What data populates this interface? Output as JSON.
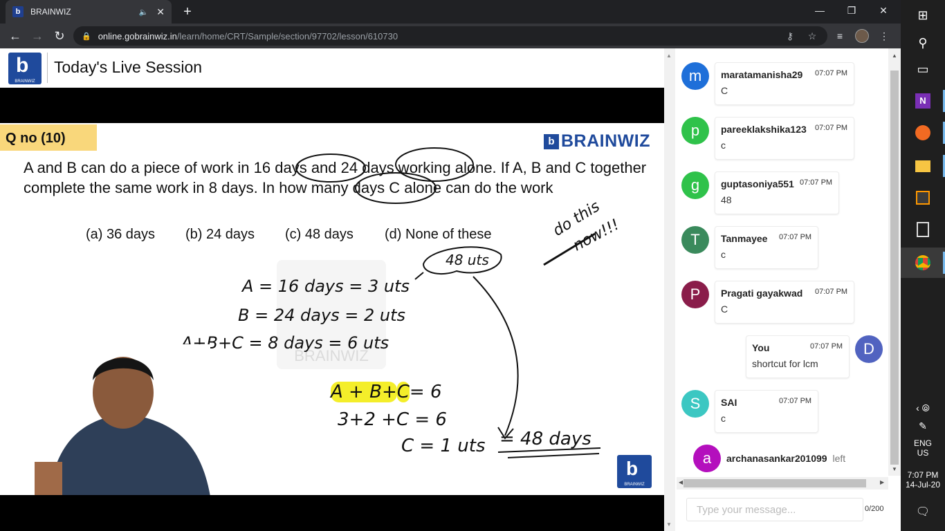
{
  "browser": {
    "tab_title": "BRAINWIZ",
    "favicon_letter": "b",
    "url_host": "online.gobrainwiz.in",
    "url_path": "/learn/home/CRT/Sample/section/97702/lesson/610730"
  },
  "header": {
    "logo_letter": "b",
    "logo_caption": "BRAINWIZ",
    "title": "Today's Live Session"
  },
  "slide": {
    "qno": "Q no (10)",
    "brand": "BRAINWIZ",
    "question": "A and B can do a piece of work in 16 days and 24 days working alone. If A, B and C together complete the same work in 8 days. In how many days C alone can do the work",
    "options": [
      "(a) 36 days",
      "(b) 24 days",
      "(c) 48 days",
      "(d) None of these"
    ],
    "handwriting": {
      "line1": "A = 16 days = 3 uts",
      "line2": "B = 24 days = 2 uts",
      "line3": "A+B+C = 8 days = 6 uts",
      "cloud": "48 uts",
      "eq1a": "A + B+",
      "eq1b": "C",
      "eq1c": "= 6",
      "eq2": "3+2 +C = 6",
      "eq3": "C = 1 uts",
      "answer": "= 48 days",
      "note1": "do this",
      "note2": "now!!!"
    },
    "watermark": "BRAINWIZ",
    "corner_logo_letter": "b",
    "corner_logo_caption": "BRAINWIZ"
  },
  "chat": {
    "messages": [
      {
        "initial": "m",
        "color": "#1e6fd9",
        "user": "maratamanisha29",
        "time": "07:07 PM",
        "text": "C"
      },
      {
        "initial": "p",
        "color": "#2fc24a",
        "user": "pareeklakshika123",
        "time": "07:07 PM",
        "text": "c"
      },
      {
        "initial": "g",
        "color": "#2fc24a",
        "user": "guptasoniya551",
        "time": "07:07 PM",
        "text": "48"
      },
      {
        "initial": "T",
        "color": "#3a8a5c",
        "user": "Tanmayee",
        "time": "07:07 PM",
        "text": "c"
      },
      {
        "initial": "P",
        "color": "#8a1d4a",
        "user": "Pragati gayakwad",
        "time": "07:07 PM",
        "text": "C"
      },
      {
        "initial": "D",
        "color": "#5163c0",
        "user": "You",
        "time": "07:07 PM",
        "text": "shortcut for lcm"
      },
      {
        "initial": "S",
        "color": "#3cc7c2",
        "user": "SAI",
        "time": "07:07 PM",
        "text": "c"
      }
    ],
    "system": {
      "initial": "a",
      "color": "#b40fbd",
      "user": "archanasankar201099",
      "action": "left"
    },
    "input_placeholder": "Type your message...",
    "char_count": "0/200"
  },
  "taskbar": {
    "lang1": "ENG",
    "lang2": "US",
    "time": "7:07 PM",
    "date": "14-Jul-20"
  }
}
